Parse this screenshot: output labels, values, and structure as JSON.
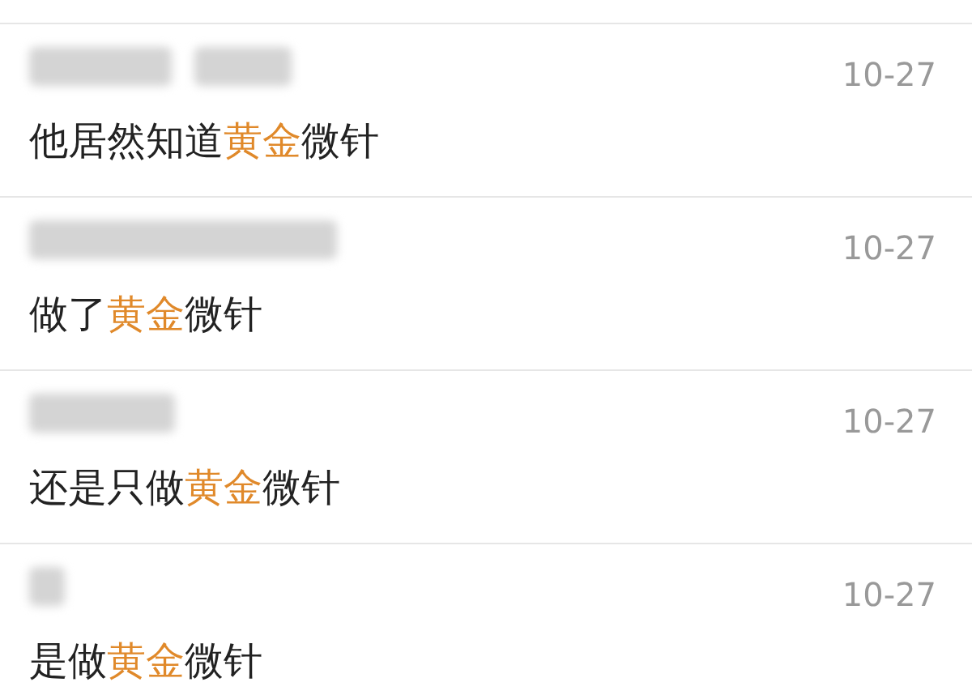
{
  "comments": [
    {
      "author_redacted": true,
      "date": "10-27",
      "segments": [
        {
          "text": "他居然知道",
          "highlight": false
        },
        {
          "text": "黄金",
          "highlight": true
        },
        {
          "text": "微针",
          "highlight": false
        }
      ]
    },
    {
      "author_redacted": true,
      "date": "10-27",
      "segments": [
        {
          "text": "做了",
          "highlight": false
        },
        {
          "text": "黄金",
          "highlight": true
        },
        {
          "text": "微针",
          "highlight": false
        }
      ]
    },
    {
      "author_redacted": true,
      "date": "10-27",
      "segments": [
        {
          "text": "还是只做",
          "highlight": false
        },
        {
          "text": "黄金",
          "highlight": true
        },
        {
          "text": "微针",
          "highlight": false
        }
      ]
    },
    {
      "author_redacted": true,
      "date": "10-27",
      "segments": [
        {
          "text": "是做",
          "highlight": false
        },
        {
          "text": "黄金",
          "highlight": true
        },
        {
          "text": "微针",
          "highlight": false
        }
      ]
    }
  ]
}
